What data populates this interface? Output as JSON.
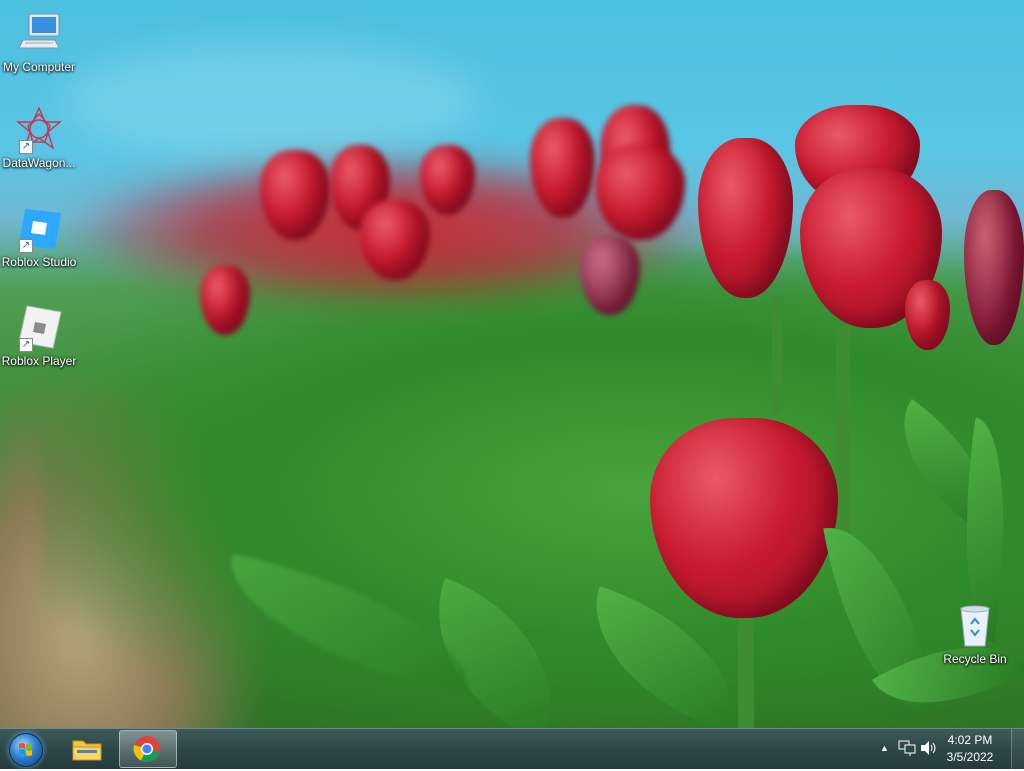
{
  "desktop": {
    "icons": [
      {
        "label": "My Computer",
        "icon": "computer-icon"
      },
      {
        "label": "DataWagon...",
        "icon": "datawagon-icon"
      },
      {
        "label": "Roblox Studio",
        "icon": "roblox-studio-icon"
      },
      {
        "label": "Roblox Player",
        "icon": "roblox-player-icon"
      },
      {
        "label": "Recycle Bin",
        "icon": "recycle-bin-icon"
      }
    ]
  },
  "taskbar": {
    "pinned": [
      {
        "name": "start-button",
        "icon": "windows-orb-icon"
      },
      {
        "name": "file-explorer",
        "icon": "folder-icon"
      },
      {
        "name": "chrome",
        "icon": "chrome-icon",
        "active": true
      }
    ],
    "tray": {
      "overflow_glyph": "▲",
      "network_icon": "network-icon",
      "volume_icon": "volume-icon"
    },
    "clock": {
      "time": "4:02 PM",
      "date": "3/5/2022"
    }
  },
  "colors": {
    "taskbar": "#2d4748",
    "sky": "#4bc0df",
    "tulip": "#c81a30",
    "grass": "#3e8c37"
  }
}
